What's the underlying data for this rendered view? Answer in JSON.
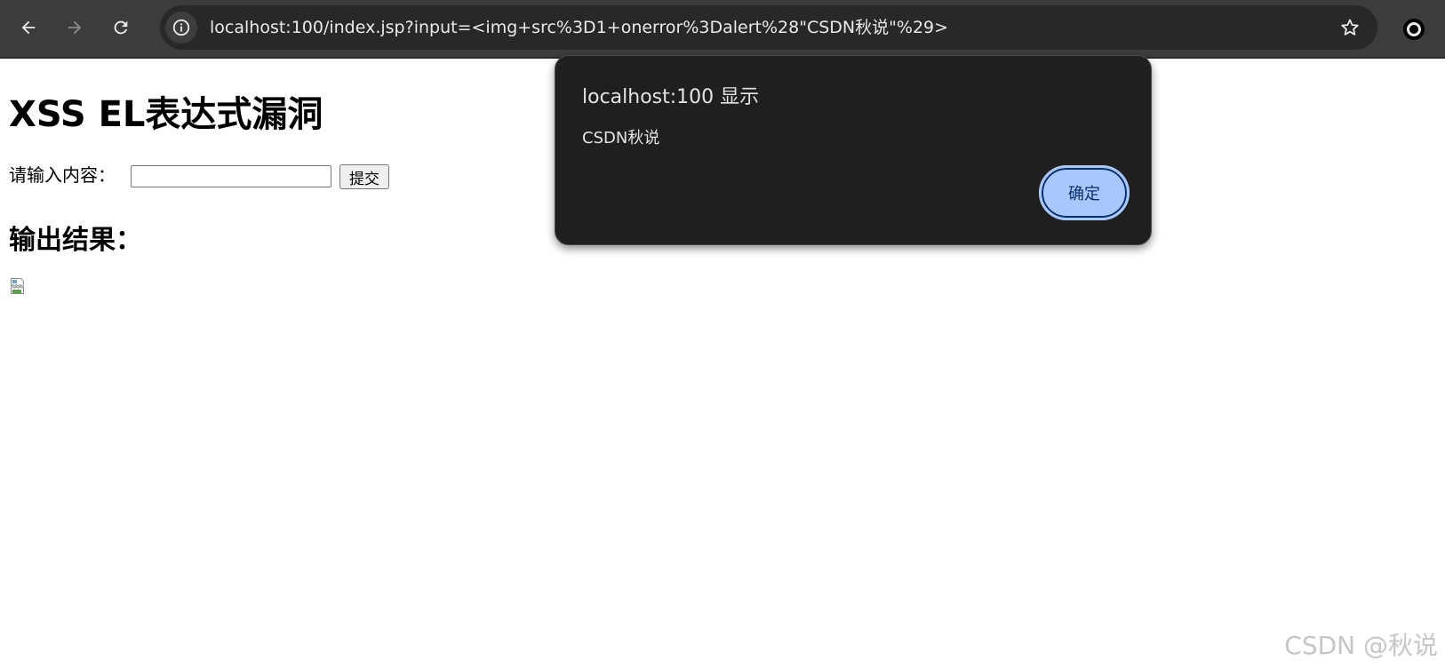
{
  "browser": {
    "url": "localhost:100/index.jsp?input=<img+src%3D1+onerror%3Dalert%28\"CSDN秋说\"%29>",
    "icons": {
      "back": "back-arrow-icon",
      "forward": "forward-arrow-icon",
      "reload": "reload-icon",
      "site_info": "info-icon",
      "bookmark": "star-icon",
      "profile": "profile-icon"
    }
  },
  "page": {
    "title": "XSS EL表达式漏洞",
    "form": {
      "label": "请输入内容：",
      "input_value": "",
      "submit_label": "提交"
    },
    "output_heading": "输出结果：",
    "output_image": "broken-image-icon"
  },
  "dialog": {
    "title": "localhost:100 显示",
    "message": "CSDN秋说",
    "ok_label": "确定"
  },
  "watermark": "CSDN @秋说",
  "colors": {
    "chrome_bg": "#3c3c3c",
    "omnibox_bg": "#282828",
    "dialog_bg": "#1f1f1f",
    "button_accent": "#a8c7fa"
  }
}
